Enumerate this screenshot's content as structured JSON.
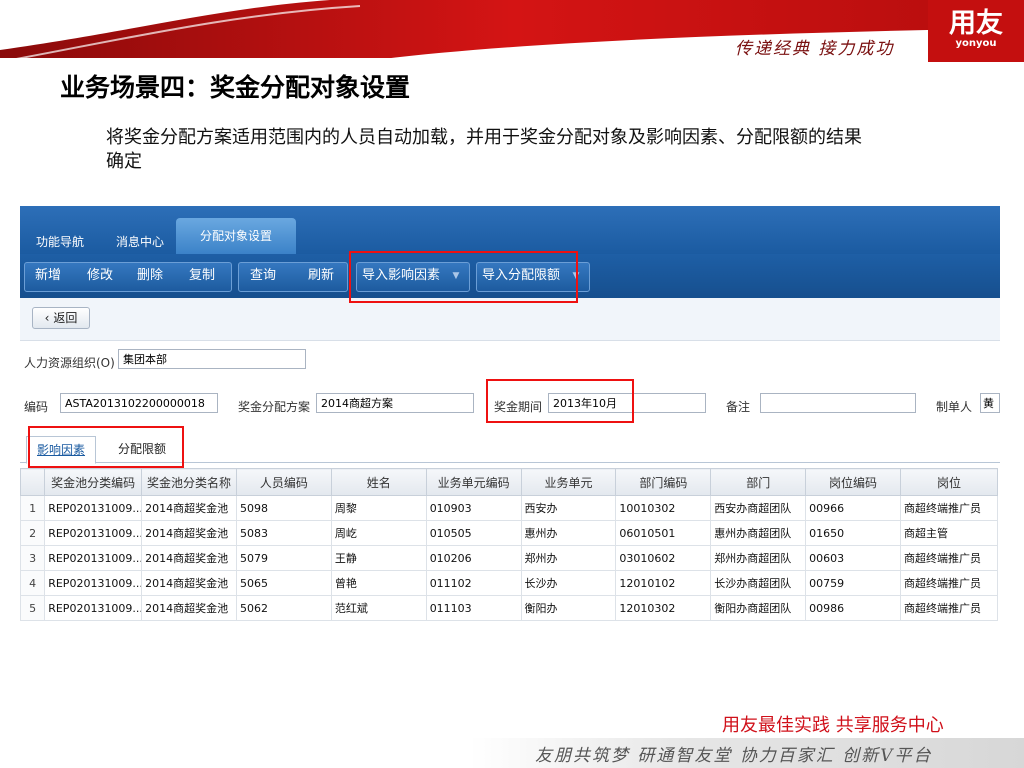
{
  "banner": {
    "slogan": "传递经典 接力成功",
    "logo_cn": "用友",
    "logo_en": "yonyou",
    "accent": "#c40f0f"
  },
  "slide": {
    "title": "业务场景四：奖金分配对象设置",
    "description": "将奖金分配方案适用范围内的人员自动加载，并用于奖金分配对象及影响因素、分配限额的结果确定"
  },
  "app": {
    "tabs": [
      "功能导航",
      "消息中心",
      "分配对象设置"
    ],
    "toolbar": {
      "add": "新增",
      "edit": "修改",
      "delete": "删除",
      "copy": "复制",
      "query": "查询",
      "refresh": "刷新",
      "import_factor": "导入影响因素",
      "import_limit": "导入分配限额"
    },
    "back_label": "返回",
    "form": {
      "org_label": "人力资源组织(O)",
      "org_value": "集团本部",
      "code_label": "编码",
      "code_value": "ASTA2013102200000018",
      "plan_label": "奖金分配方案",
      "plan_value": "2014商超方案",
      "period_label": "奖金期间",
      "period_value": "2013年10月",
      "remark_label": "备注",
      "remark_value": "",
      "creator_label": "制单人",
      "creator_value": "黄"
    },
    "subtabs": [
      "影响因素",
      "分配限额"
    ],
    "table": {
      "columns": [
        "",
        "奖金池分类编码",
        "奖金池分类名称",
        "人员编码",
        "姓名",
        "业务单元编码",
        "业务单元",
        "部门编码",
        "部门",
        "岗位编码",
        "岗位"
      ],
      "rows": [
        [
          "1",
          "REP020131009...",
          "2014商超奖金池",
          "5098",
          "周黎",
          "010903",
          "西安办",
          "10010302",
          "西安办商超团队",
          "00966",
          "商超终端推广员"
        ],
        [
          "2",
          "REP020131009...",
          "2014商超奖金池",
          "5083",
          "周屹",
          "010505",
          "惠州办",
          "06010501",
          "惠州办商超团队",
          "01650",
          "商超主管"
        ],
        [
          "3",
          "REP020131009...",
          "2014商超奖金池",
          "5079",
          "王静",
          "010206",
          "郑州办",
          "03010602",
          "郑州办商超团队",
          "00603",
          "商超终端推广员"
        ],
        [
          "4",
          "REP020131009...",
          "2014商超奖金池",
          "5065",
          "曾艳",
          "011102",
          "长沙办",
          "12010102",
          "长沙办商超团队",
          "00759",
          "商超终端推广员"
        ],
        [
          "5",
          "REP020131009...",
          "2014商超奖金池",
          "5062",
          "范红斌",
          "011103",
          "衡阳办",
          "12010302",
          "衡阳办商超团队",
          "00986",
          "商超终端推广员"
        ]
      ]
    }
  },
  "footer": {
    "center": "用友最佳实践  共享服务中心",
    "motto": "友朋共筑梦 研通智友堂 协力百家汇 创新V平台"
  }
}
